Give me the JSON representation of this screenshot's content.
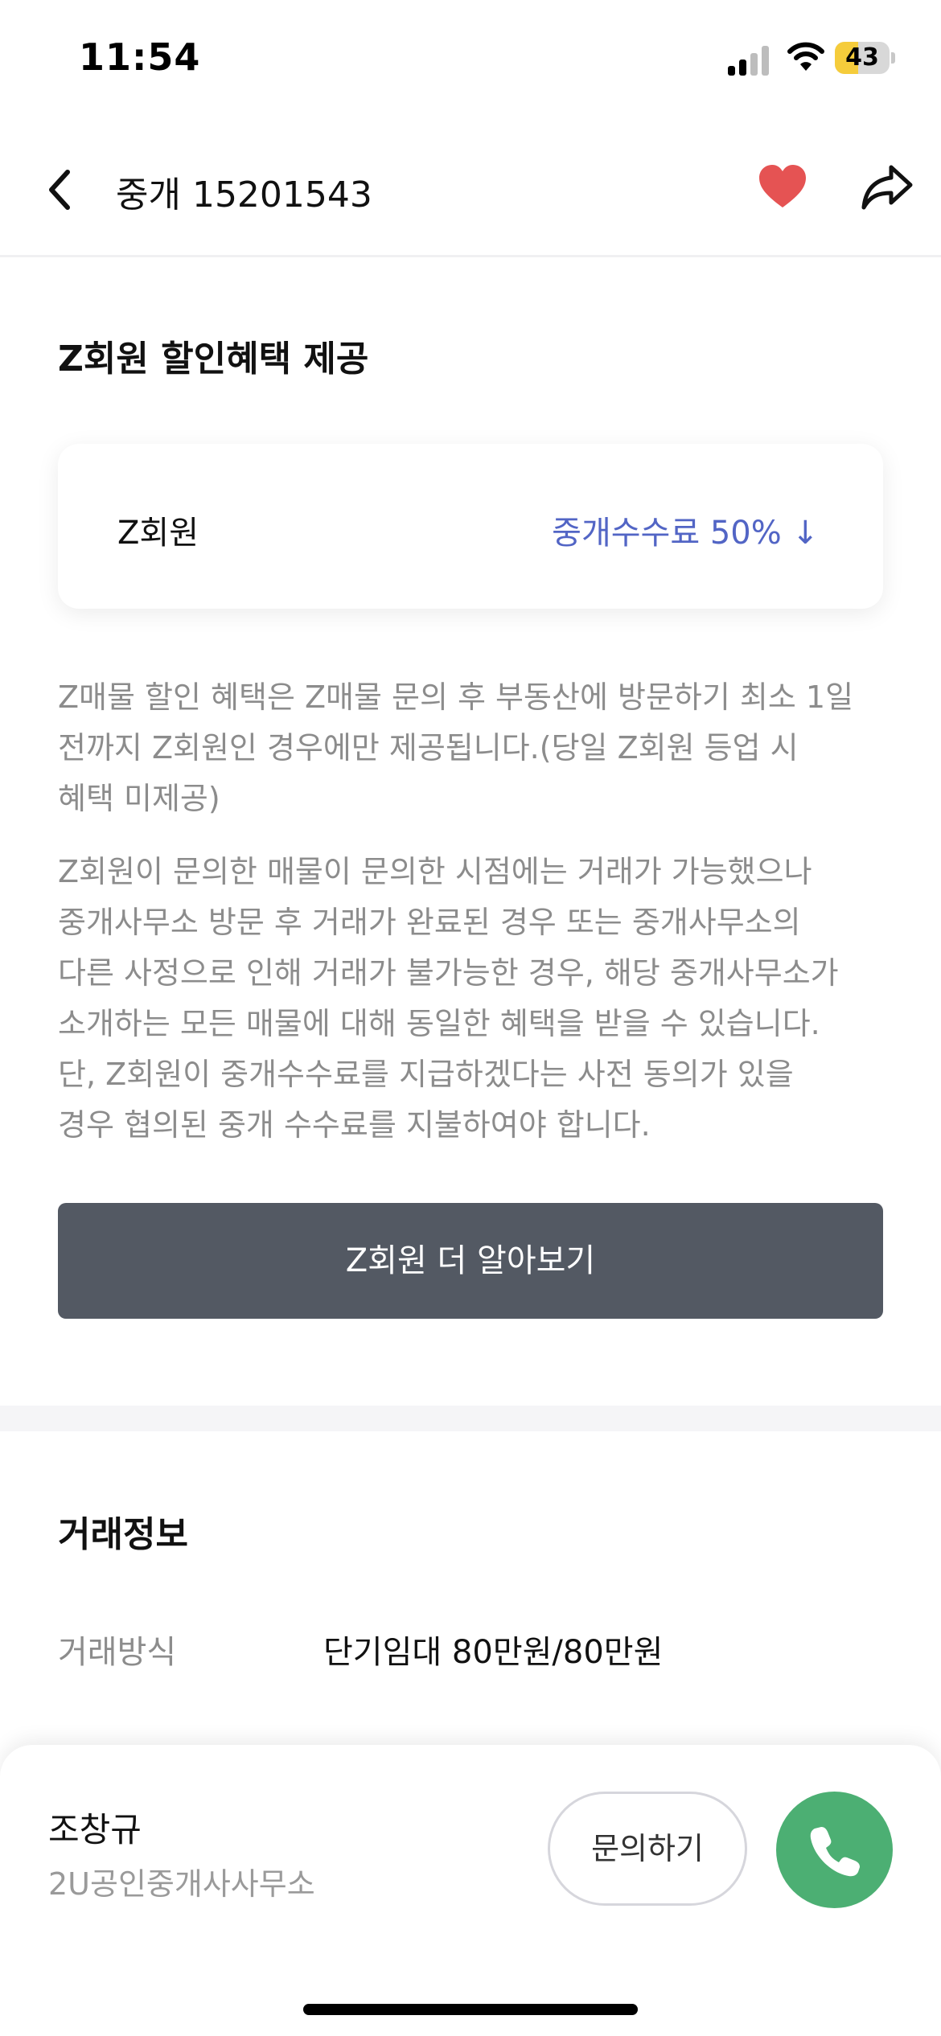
{
  "status_bar": {
    "time": "11:54",
    "battery": "43",
    "battery_level": 0.43,
    "battery_color": "#f5cc3b"
  },
  "header": {
    "title": "중개 15201543",
    "back_icon": "chevron-left-icon",
    "favorite_icon": "heart-filled-icon",
    "favorite_color": "#e55353",
    "share_icon": "share-arrow-icon"
  },
  "z_benefit": {
    "title": "Z회원 할인혜택 제공",
    "card": {
      "member": "Z회원",
      "discount": "중개수수료 50% ↓",
      "discount_color": "#5265c5"
    },
    "notice_1_lines": [
      "Z매물 할인 혜택은 Z매물 문의 후 부동산에 방문하기 최소 1일",
      "전까지 Z회원인 경우에만 제공됩니다.(당일 Z회원 등업 시",
      "혜택 미제공)"
    ],
    "notice_2_lines": [
      "Z회원이 문의한 매물이 문의한 시점에는 거래가 가능했으나",
      "중개사무소 방문 후 거래가 완료된 경우 또는 중개사무소의",
      "다른 사정으로 인해 거래가 불가능한 경우, 해당 중개사무소가",
      "소개하는 모든 매물에 대해 동일한 혜택을 받을 수 있습니다.",
      "단, Z회원이 중개수수료를 지급하겠다는 사전 동의가 있을",
      "경우 협의된 중개 수수료를 지불하여야 합니다."
    ],
    "learn_more_button": "Z회원 더 알아보기"
  },
  "trade_info": {
    "title": "거래정보",
    "rows": [
      {
        "label": "거래방식",
        "value": "단기임대 80만원/80만원"
      }
    ]
  },
  "bottom_bar": {
    "agent_name": "조창규",
    "office_name": "2U공인중개사사무소",
    "inquiry_button": "문의하기",
    "call_icon": "phone-icon",
    "call_color": "#4caf73"
  }
}
